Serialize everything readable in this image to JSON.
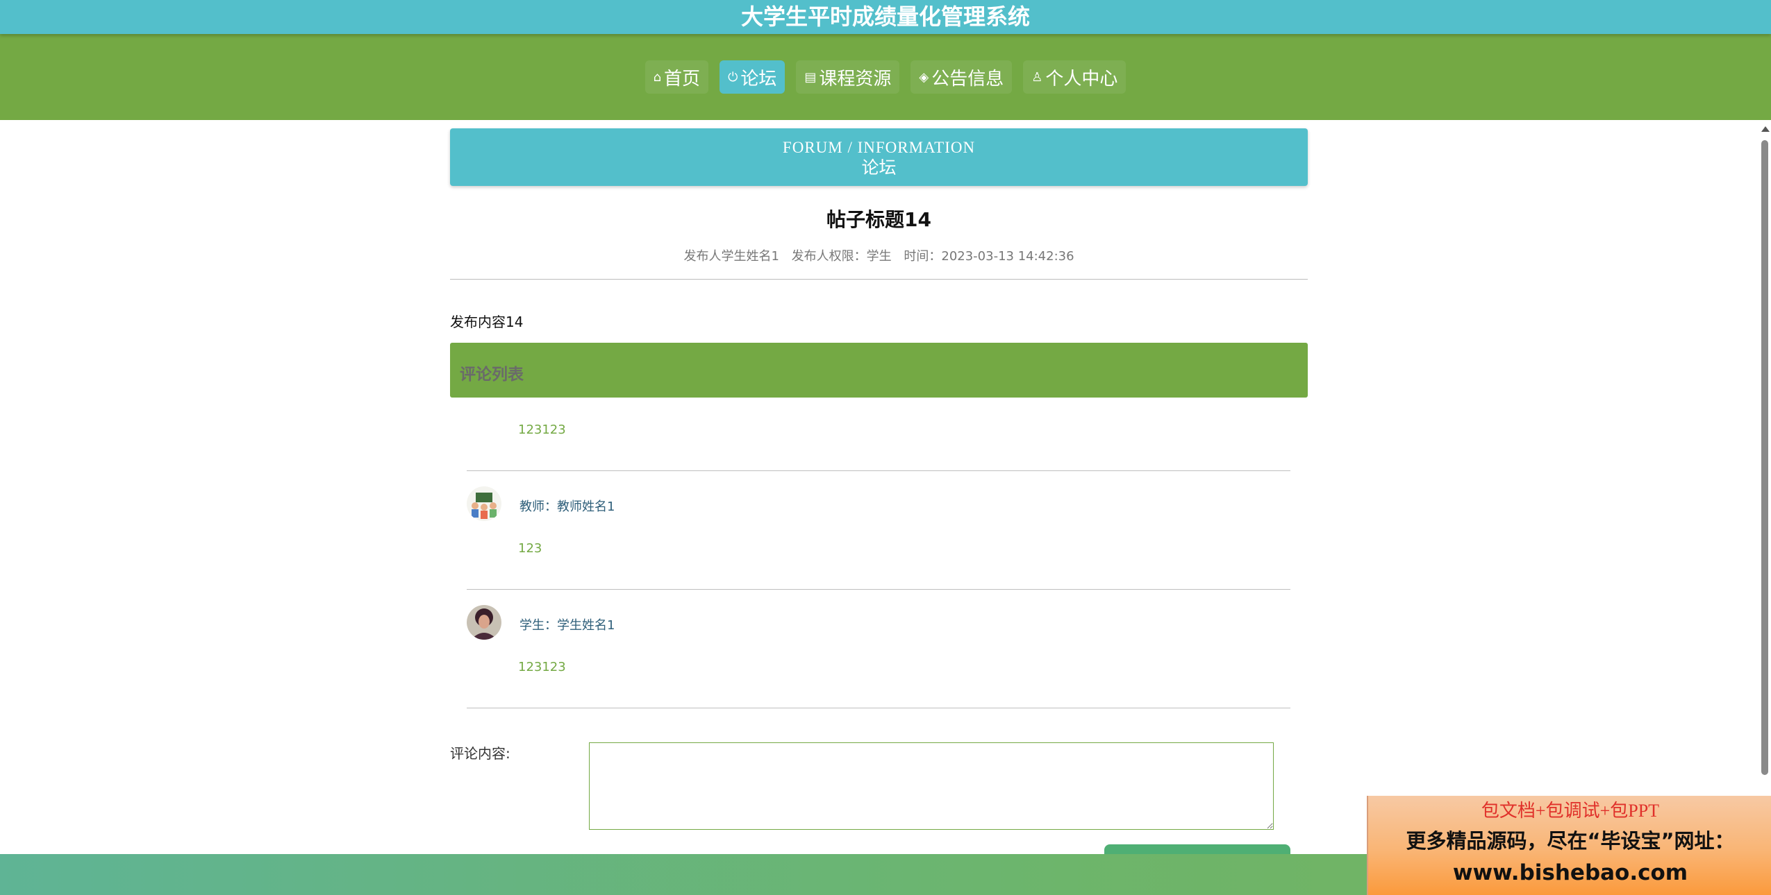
{
  "app": {
    "title": "大学生平时成绩量化管理系统"
  },
  "nav": {
    "items": [
      {
        "label": "首页",
        "icon": "home-icon"
      },
      {
        "label": "论坛",
        "icon": "power-icon"
      },
      {
        "label": "课程资源",
        "icon": "box-icon"
      },
      {
        "label": "公告信息",
        "icon": "layers-icon"
      },
      {
        "label": "个人中心",
        "icon": "user-icon"
      }
    ],
    "active": "论坛"
  },
  "banner": {
    "en": "FORUM / INFORMATION",
    "cn": "论坛"
  },
  "post": {
    "title": "帖子标题14",
    "author": "发布人学生姓名1",
    "role": "发布人权限：学生",
    "time": "时间：2023-03-13 14:42:36",
    "content": "发布内容14"
  },
  "comments": {
    "header": "评论列表",
    "items": [
      {
        "author": "",
        "content": "123123",
        "avatar": "none"
      },
      {
        "author": "教师：教师姓名1",
        "content": "123",
        "avatar": "teacher-avatar"
      },
      {
        "author": "学生：学生姓名1",
        "content": "123123",
        "avatar": "student-avatar"
      }
    ]
  },
  "form": {
    "label": "评论内容:",
    "value": ""
  },
  "ad": {
    "line1": "包文档+包调试+包PPT",
    "line2": "更多精品源码，尽在“毕设宝”网址：",
    "line3": "www.bishebao.com"
  },
  "colors": {
    "header": "#53bfcb",
    "nav": "#74a944",
    "footer": "#64b482"
  }
}
